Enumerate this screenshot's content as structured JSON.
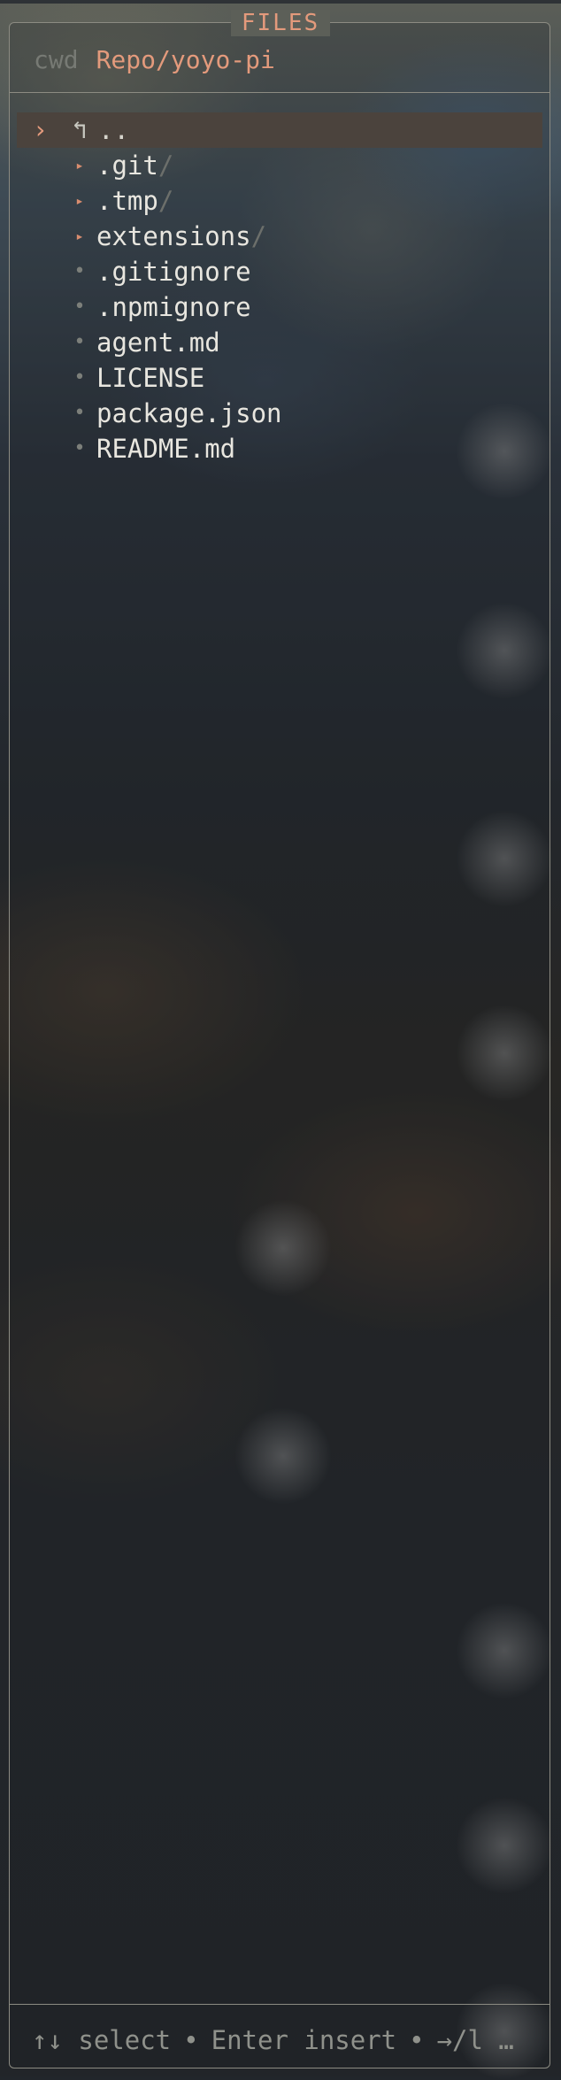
{
  "panel": {
    "title": "FILES",
    "cwd_label": "cwd",
    "cwd_path": "Repo/yoyo-pi"
  },
  "entries": [
    {
      "name": "..",
      "type": "parent",
      "selected": true,
      "caret": "›",
      "icon": "↰"
    },
    {
      "name": ".git",
      "type": "folder",
      "suffix": "/"
    },
    {
      "name": ".tmp",
      "type": "folder",
      "suffix": "/"
    },
    {
      "name": "extensions",
      "type": "folder",
      "suffix": "/"
    },
    {
      "name": ".gitignore",
      "type": "file"
    },
    {
      "name": ".npmignore",
      "type": "file"
    },
    {
      "name": "agent.md",
      "type": "file"
    },
    {
      "name": "LICENSE",
      "type": "file"
    },
    {
      "name": "package.json",
      "type": "file"
    },
    {
      "name": "README.md",
      "type": "file"
    }
  ],
  "icons": {
    "folder": "folder-triangle-icon",
    "file": "file-dot-icon",
    "parent": "parent-directory-icon"
  },
  "footer": {
    "select": "↑↓ select",
    "insert": "Enter insert",
    "open": "→/l …",
    "separator": "•"
  },
  "colors": {
    "accent": "#e39a7c",
    "text": "#e8e6df",
    "muted": "#777a74",
    "selection": "#4b433d"
  }
}
